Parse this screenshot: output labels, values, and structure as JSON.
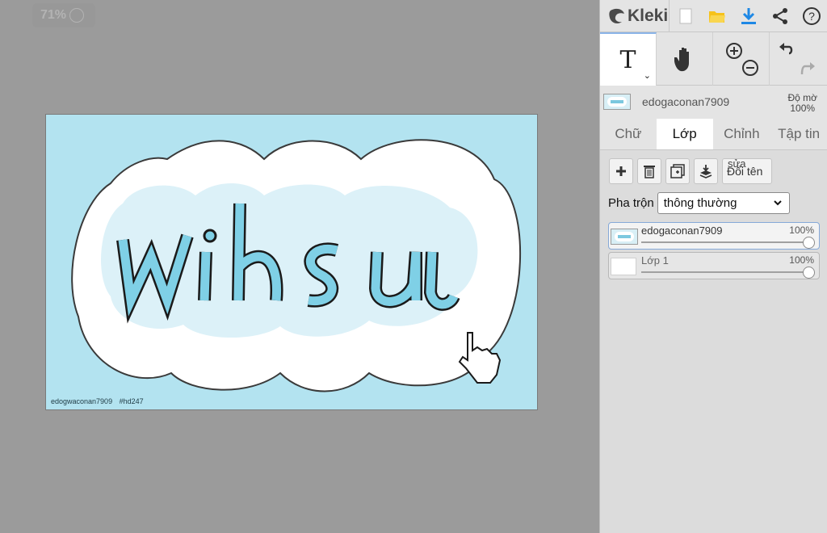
{
  "stage": {
    "zoom_label": "71%"
  },
  "canvas": {
    "watermark_user": "edogwaconan7909",
    "watermark_tag": "#hd247",
    "art_word": "wihsu",
    "colors": {
      "background": "#b3e3f0",
      "cloud_outer": "#ffffff",
      "cloud_inner": "#dcf1f8",
      "letter_fill": "#7fd0e6",
      "letter_outline": "#1a1a1a"
    }
  },
  "app": {
    "logo": "Kleki",
    "toolbar": {
      "new_icon": "new-file-icon",
      "open_icon": "open-folder-icon",
      "save_icon": "download-icon",
      "share_icon": "share-icon",
      "help_icon": "help-icon"
    },
    "tools": {
      "text_glyph": "T",
      "hand_icon": "hand-icon",
      "zoom_in_icon": "zoom-in-icon",
      "zoom_out_icon": "zoom-out-icon",
      "undo_icon": "undo-icon",
      "redo_icon": "redo-icon"
    },
    "layer_info": {
      "name": "edogaconan7909",
      "opacity_label": "Độ mờ",
      "opacity_value": "100%"
    },
    "tabs": [
      "Chữ",
      "Lớp",
      "Chỉnh",
      "Tập tin"
    ],
    "active_tab": "Lớp",
    "layers_panel": {
      "rename_small": "sửa",
      "rename_label": "Đổi tên",
      "blend_label": "Pha trộn",
      "blend_value": "thông thường",
      "layers": [
        {
          "name": "edogaconan7909",
          "opacity": "100%",
          "opacity_value": 1.0,
          "selected": true
        },
        {
          "name": "Lớp 1",
          "opacity": "100%",
          "opacity_value": 1.0,
          "selected": false
        }
      ]
    },
    "accent_color": "#1e88e5",
    "folder_color": "#f6c21b"
  }
}
